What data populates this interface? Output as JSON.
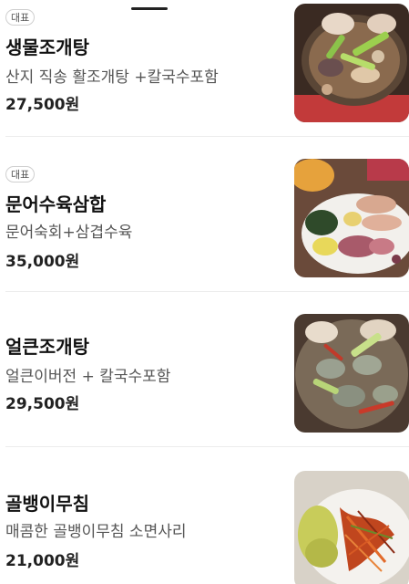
{
  "menu": {
    "items": [
      {
        "badge": "대표",
        "name": "생물조개탕",
        "description": "산지 직송 활조개탕 +칼국수포함",
        "price": "27,500원",
        "image": "seafood-clam-stew-photo"
      },
      {
        "badge": "대표",
        "name": "문어수육삼합",
        "description": "문어숙회+삼겹수육",
        "price": "35,000원",
        "image": "octopus-pork-platter-photo"
      },
      {
        "name": "얼큰조개탕",
        "description": "얼큰이버전 + 칼국수포함",
        "price": "29,500원",
        "image": "spicy-clam-stew-photo"
      },
      {
        "name": "골뱅이무침",
        "description": "매콤한 골뱅이무침 소면사리",
        "price": "21,000원",
        "image": "spicy-whelk-salad-photo"
      }
    ]
  },
  "colors": {
    "text_primary": "#111111",
    "text_secondary": "#555555",
    "divider": "#ececec",
    "badge_border": "#cfcfcf"
  }
}
